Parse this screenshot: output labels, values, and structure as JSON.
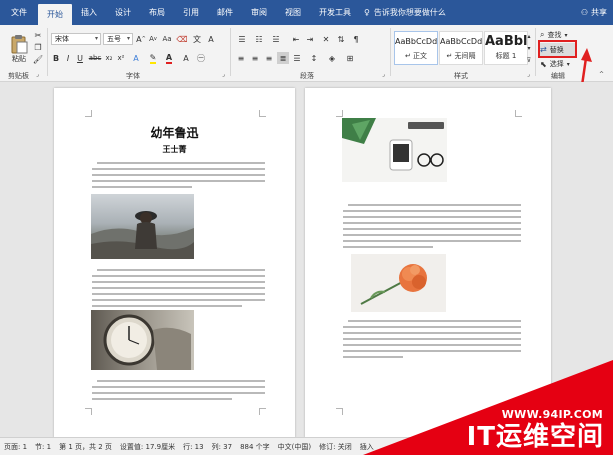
{
  "tabs": [
    {
      "label": "文件",
      "active": false
    },
    {
      "label": "开始",
      "active": true
    },
    {
      "label": "插入",
      "active": false
    },
    {
      "label": "设计",
      "active": false
    },
    {
      "label": "布局",
      "active": false
    },
    {
      "label": "引用",
      "active": false
    },
    {
      "label": "邮件",
      "active": false
    },
    {
      "label": "审阅",
      "active": false
    },
    {
      "label": "视图",
      "active": false
    },
    {
      "label": "开发工具",
      "active": false
    }
  ],
  "tell_me": "告诉我你想要做什么",
  "share": "共享",
  "ribbon": {
    "paste_label": "粘贴",
    "font_name": "宋体",
    "font_size": "五号",
    "groups": {
      "clipboard": "剪贴板",
      "font": "字体",
      "paragraph": "段落",
      "styles": "样式",
      "editing": "编辑"
    },
    "styles": [
      {
        "sample": "AaBbCcDd",
        "name": "↵ 正文"
      },
      {
        "sample": "AaBbCcDd",
        "name": "↵ 无间隔"
      },
      {
        "sample": "AaBbl",
        "name": "标题 1"
      }
    ],
    "editing": {
      "find": "查找",
      "replace": "替换",
      "select": "选择"
    }
  },
  "document": {
    "page1_title": "幼年鲁迅",
    "page1_author": "王士菁"
  },
  "status_bar": {
    "page": "页面: 1",
    "section": "节: 1",
    "page_of": "第 1 页，共 2 页",
    "position": "设置值: 17.9厘米",
    "line": "行: 13",
    "column": "列: 37",
    "word_count": "884 个字",
    "language": "中文(中国)",
    "track": "修订: 关闭",
    "mode": "插入"
  },
  "watermark": {
    "url": "WWW.94IP.COM",
    "brand": "IT运维空间"
  },
  "colors": {
    "accent": "#2b579a",
    "highlight_box": "#e02020",
    "watermark_bg": "#e50012"
  }
}
